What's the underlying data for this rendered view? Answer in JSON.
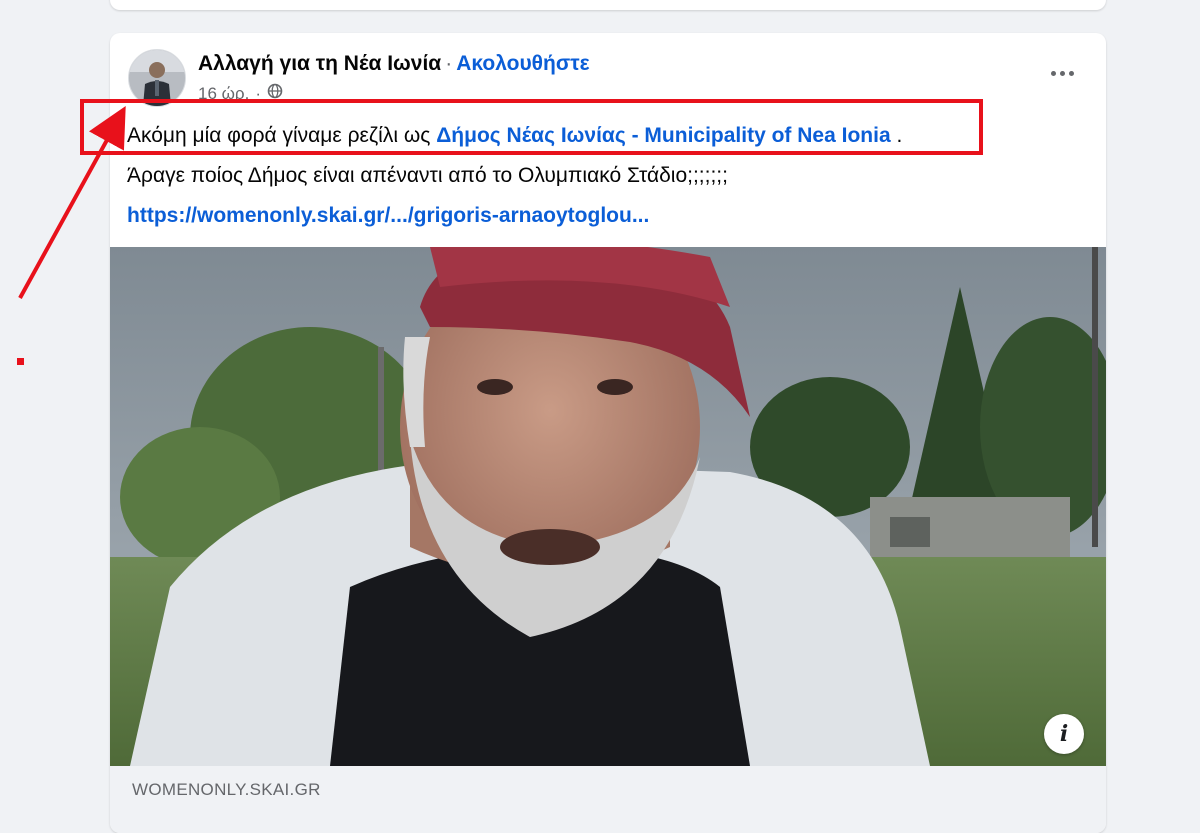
{
  "post": {
    "page_name": "Αλλαγή για τη Νέα Ιωνία",
    "separator": "·",
    "follow_label": "Ακολουθήστε",
    "time": "16 ώρ.",
    "time_dot": "·",
    "privacy_icon": "globe-icon",
    "more_icon": "more-options-icon",
    "line1_prefix": "Ακόμη μία φορά γίναμε  ρεζίλι ως ",
    "line1_mention": "Δήμος Νέας Ιωνίας - Municipality of Nea Ionia",
    "line1_suffix": " .",
    "line2": "Άραγε ποίος Δήμος είναι απέναντι από το Ολυμπιακό Στάδιο;;;;;;;",
    "link": "https://womenonly.skai.gr/.../grigoris-arnaoytoglou..."
  },
  "link_preview": {
    "domain": "WOMENONLY.SKAI.GR",
    "info_icon": "info-icon",
    "info_glyph": "i"
  },
  "colors": {
    "link_blue": "#0b5ed7",
    "annotation_red": "#e8111b",
    "page_bg": "#f0f2f5"
  }
}
